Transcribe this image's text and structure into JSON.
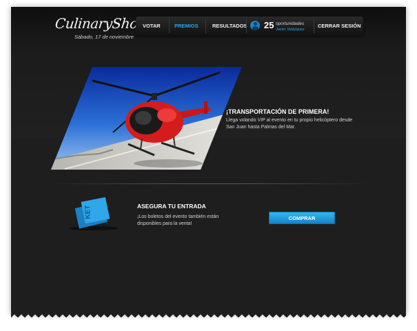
{
  "brand": {
    "logo_text": "CulinaryShowcase",
    "date": "Sábado, 17 de noviembre"
  },
  "nav": {
    "items": [
      {
        "label": "VOTAR",
        "active": false
      },
      {
        "label": "PREMIOS",
        "active": true
      },
      {
        "label": "RESULTADOS",
        "active": false
      }
    ],
    "opportunities_count": "25",
    "opportunities_label": "oportunidades",
    "user_name": "Javier Velázquez",
    "logout_label": "CERRAR SESIÓN"
  },
  "promo": {
    "title": "¡TRANSPORTACIÓN DE PRIMERA!",
    "description": "Llega volando VIP al evento en tu propio helicóptero desde San Juan hasta Palmas del Mar."
  },
  "tickets": {
    "title": "ASEGURA TU ENTRADA",
    "description": "¡Los boletos del evento también están disponibles para la venta!",
    "button_label": "COMPRAR",
    "ticket_text": "KET"
  },
  "colors": {
    "accent": "#2ea6e6",
    "background": "#1e1e1e",
    "button": "#1f9ee0"
  }
}
